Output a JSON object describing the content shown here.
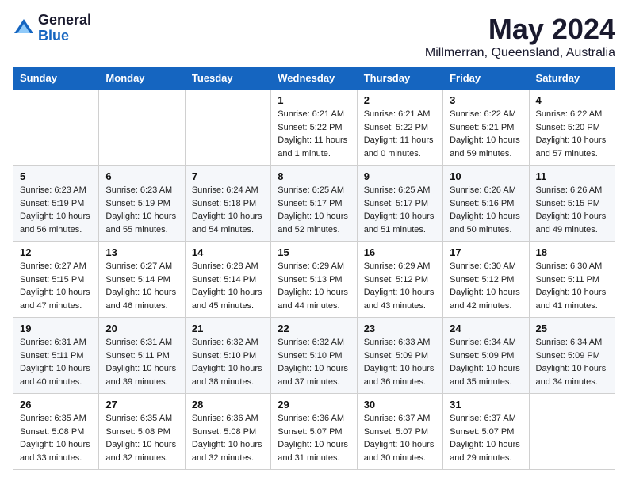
{
  "logo": {
    "general": "General",
    "blue": "Blue"
  },
  "header": {
    "month": "May 2024",
    "location": "Millmerran, Queensland, Australia"
  },
  "days_of_week": [
    "Sunday",
    "Monday",
    "Tuesday",
    "Wednesday",
    "Thursday",
    "Friday",
    "Saturday"
  ],
  "weeks": [
    [
      {
        "day": "",
        "info": ""
      },
      {
        "day": "",
        "info": ""
      },
      {
        "day": "",
        "info": ""
      },
      {
        "day": "1",
        "info": "Sunrise: 6:21 AM\nSunset: 5:22 PM\nDaylight: 11 hours\nand 1 minute."
      },
      {
        "day": "2",
        "info": "Sunrise: 6:21 AM\nSunset: 5:22 PM\nDaylight: 11 hours\nand 0 minutes."
      },
      {
        "day": "3",
        "info": "Sunrise: 6:22 AM\nSunset: 5:21 PM\nDaylight: 10 hours\nand 59 minutes."
      },
      {
        "day": "4",
        "info": "Sunrise: 6:22 AM\nSunset: 5:20 PM\nDaylight: 10 hours\nand 57 minutes."
      }
    ],
    [
      {
        "day": "5",
        "info": "Sunrise: 6:23 AM\nSunset: 5:19 PM\nDaylight: 10 hours\nand 56 minutes."
      },
      {
        "day": "6",
        "info": "Sunrise: 6:23 AM\nSunset: 5:19 PM\nDaylight: 10 hours\nand 55 minutes."
      },
      {
        "day": "7",
        "info": "Sunrise: 6:24 AM\nSunset: 5:18 PM\nDaylight: 10 hours\nand 54 minutes."
      },
      {
        "day": "8",
        "info": "Sunrise: 6:25 AM\nSunset: 5:17 PM\nDaylight: 10 hours\nand 52 minutes."
      },
      {
        "day": "9",
        "info": "Sunrise: 6:25 AM\nSunset: 5:17 PM\nDaylight: 10 hours\nand 51 minutes."
      },
      {
        "day": "10",
        "info": "Sunrise: 6:26 AM\nSunset: 5:16 PM\nDaylight: 10 hours\nand 50 minutes."
      },
      {
        "day": "11",
        "info": "Sunrise: 6:26 AM\nSunset: 5:15 PM\nDaylight: 10 hours\nand 49 minutes."
      }
    ],
    [
      {
        "day": "12",
        "info": "Sunrise: 6:27 AM\nSunset: 5:15 PM\nDaylight: 10 hours\nand 47 minutes."
      },
      {
        "day": "13",
        "info": "Sunrise: 6:27 AM\nSunset: 5:14 PM\nDaylight: 10 hours\nand 46 minutes."
      },
      {
        "day": "14",
        "info": "Sunrise: 6:28 AM\nSunset: 5:14 PM\nDaylight: 10 hours\nand 45 minutes."
      },
      {
        "day": "15",
        "info": "Sunrise: 6:29 AM\nSunset: 5:13 PM\nDaylight: 10 hours\nand 44 minutes."
      },
      {
        "day": "16",
        "info": "Sunrise: 6:29 AM\nSunset: 5:12 PM\nDaylight: 10 hours\nand 43 minutes."
      },
      {
        "day": "17",
        "info": "Sunrise: 6:30 AM\nSunset: 5:12 PM\nDaylight: 10 hours\nand 42 minutes."
      },
      {
        "day": "18",
        "info": "Sunrise: 6:30 AM\nSunset: 5:11 PM\nDaylight: 10 hours\nand 41 minutes."
      }
    ],
    [
      {
        "day": "19",
        "info": "Sunrise: 6:31 AM\nSunset: 5:11 PM\nDaylight: 10 hours\nand 40 minutes."
      },
      {
        "day": "20",
        "info": "Sunrise: 6:31 AM\nSunset: 5:11 PM\nDaylight: 10 hours\nand 39 minutes."
      },
      {
        "day": "21",
        "info": "Sunrise: 6:32 AM\nSunset: 5:10 PM\nDaylight: 10 hours\nand 38 minutes."
      },
      {
        "day": "22",
        "info": "Sunrise: 6:32 AM\nSunset: 5:10 PM\nDaylight: 10 hours\nand 37 minutes."
      },
      {
        "day": "23",
        "info": "Sunrise: 6:33 AM\nSunset: 5:09 PM\nDaylight: 10 hours\nand 36 minutes."
      },
      {
        "day": "24",
        "info": "Sunrise: 6:34 AM\nSunset: 5:09 PM\nDaylight: 10 hours\nand 35 minutes."
      },
      {
        "day": "25",
        "info": "Sunrise: 6:34 AM\nSunset: 5:09 PM\nDaylight: 10 hours\nand 34 minutes."
      }
    ],
    [
      {
        "day": "26",
        "info": "Sunrise: 6:35 AM\nSunset: 5:08 PM\nDaylight: 10 hours\nand 33 minutes."
      },
      {
        "day": "27",
        "info": "Sunrise: 6:35 AM\nSunset: 5:08 PM\nDaylight: 10 hours\nand 32 minutes."
      },
      {
        "day": "28",
        "info": "Sunrise: 6:36 AM\nSunset: 5:08 PM\nDaylight: 10 hours\nand 32 minutes."
      },
      {
        "day": "29",
        "info": "Sunrise: 6:36 AM\nSunset: 5:07 PM\nDaylight: 10 hours\nand 31 minutes."
      },
      {
        "day": "30",
        "info": "Sunrise: 6:37 AM\nSunset: 5:07 PM\nDaylight: 10 hours\nand 30 minutes."
      },
      {
        "day": "31",
        "info": "Sunrise: 6:37 AM\nSunset: 5:07 PM\nDaylight: 10 hours\nand 29 minutes."
      },
      {
        "day": "",
        "info": ""
      }
    ]
  ]
}
